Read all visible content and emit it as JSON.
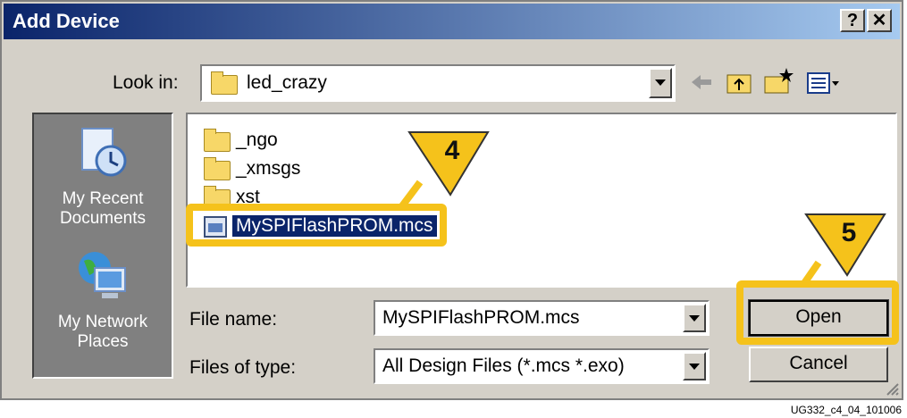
{
  "window": {
    "title": "Add Device",
    "help_label": "?",
    "close_label": "✕"
  },
  "lookin": {
    "label": "Look in:",
    "value": "led_crazy"
  },
  "toolbar": {
    "icons": [
      "back-arrow-icon",
      "up-folder-icon",
      "new-folder-icon",
      "view-menu-icon"
    ]
  },
  "places": [
    {
      "label_line1": "My Recent",
      "label_line2": "Documents",
      "icon": "recent-documents-icon"
    },
    {
      "label_line1": "My Network",
      "label_line2": "Places",
      "icon": "network-places-icon"
    }
  ],
  "files": [
    {
      "name": "_ngo",
      "type": "folder"
    },
    {
      "name": "_xmsgs",
      "type": "folder"
    },
    {
      "name": "xst",
      "type": "folder"
    },
    {
      "name": "MySPIFlashPROM.mcs",
      "type": "file",
      "selected": true
    }
  ],
  "filename": {
    "label": "File name:",
    "value": "MySPIFlashPROM.mcs"
  },
  "filetype": {
    "label": "Files of type:",
    "value": "All Design Files (*.mcs *.exo)"
  },
  "buttons": {
    "open": "Open",
    "cancel": "Cancel"
  },
  "callouts": {
    "step4": "4",
    "step5": "5"
  },
  "caption": "UG332_c4_04_101006",
  "colors": {
    "highlight": "#f5c21b",
    "selection": "#0a246a",
    "titlebar": "#0a246a"
  }
}
